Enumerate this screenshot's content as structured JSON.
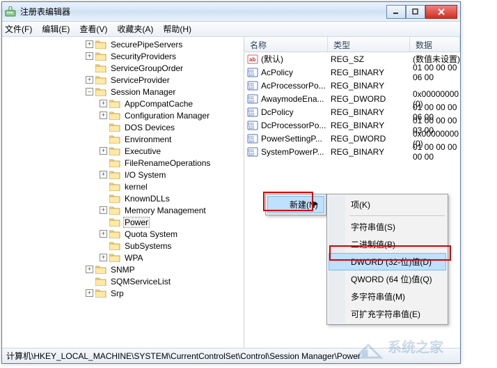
{
  "window": {
    "title": "注册表编辑器"
  },
  "menubar": {
    "file": "文件(F)",
    "edit": "编辑(E)",
    "view": "查看(V)",
    "favorites": "收藏夹(A)",
    "help": "帮助(H)"
  },
  "tree": {
    "items": [
      {
        "depth": 4,
        "exp": "+",
        "label": "SecurePipeServers"
      },
      {
        "depth": 4,
        "exp": "+",
        "label": "SecurityProviders"
      },
      {
        "depth": 4,
        "exp": " ",
        "label": "ServiceGroupOrder"
      },
      {
        "depth": 4,
        "exp": "+",
        "label": "ServiceProvider"
      },
      {
        "depth": 4,
        "exp": "–",
        "label": "Session Manager",
        "open": true
      },
      {
        "depth": 5,
        "exp": "+",
        "label": "AppCompatCache"
      },
      {
        "depth": 5,
        "exp": "+",
        "label": "Configuration Manager"
      },
      {
        "depth": 5,
        "exp": " ",
        "label": "DOS Devices"
      },
      {
        "depth": 5,
        "exp": " ",
        "label": "Environment"
      },
      {
        "depth": 5,
        "exp": "+",
        "label": "Executive"
      },
      {
        "depth": 5,
        "exp": " ",
        "label": "FileRenameOperations"
      },
      {
        "depth": 5,
        "exp": "+",
        "label": "I/O System"
      },
      {
        "depth": 5,
        "exp": " ",
        "label": "kernel"
      },
      {
        "depth": 5,
        "exp": " ",
        "label": "KnownDLLs"
      },
      {
        "depth": 5,
        "exp": "+",
        "label": "Memory Management"
      },
      {
        "depth": 5,
        "exp": " ",
        "label": "Power",
        "selected": true
      },
      {
        "depth": 5,
        "exp": "+",
        "label": "Quota System"
      },
      {
        "depth": 5,
        "exp": " ",
        "label": "SubSystems"
      },
      {
        "depth": 5,
        "exp": "+",
        "label": "WPA"
      },
      {
        "depth": 4,
        "exp": "+",
        "label": "SNMP"
      },
      {
        "depth": 4,
        "exp": " ",
        "label": "SQMServiceList"
      },
      {
        "depth": 4,
        "exp": "+",
        "label": "Srp"
      }
    ]
  },
  "list": {
    "columns": {
      "name": "名称",
      "type": "类型",
      "data": "数据"
    },
    "rows": [
      {
        "icon": "str",
        "name": "(默认)",
        "type": "REG_SZ",
        "data": "(数值未设置)"
      },
      {
        "icon": "bin",
        "name": "AcPolicy",
        "type": "REG_BINARY",
        "data": "01 00 00 00 06 00"
      },
      {
        "icon": "bin",
        "name": "AcProcessorPo...",
        "type": "REG_BINARY",
        "data": ""
      },
      {
        "icon": "bin",
        "name": "AwaymodeEna...",
        "type": "REG_DWORD",
        "data": "0x00000000 (0)"
      },
      {
        "icon": "bin",
        "name": "DcPolicy",
        "type": "REG_BINARY",
        "data": "01 00 00 00 06 00"
      },
      {
        "icon": "bin",
        "name": "DcProcessorPo...",
        "type": "REG_BINARY",
        "data": "01 00 00 00 03 00"
      },
      {
        "icon": "bin",
        "name": "PowerSettingP...",
        "type": "REG_DWORD",
        "data": "0x00000000 (0)"
      },
      {
        "icon": "bin",
        "name": "SystemPowerP...",
        "type": "REG_BINARY",
        "data": "01 00 00 00 00 00"
      }
    ]
  },
  "contextmenu": {
    "new_label": "新建(N)",
    "submenu": [
      {
        "label": "项(K)",
        "sep_after": true
      },
      {
        "label": "字符串值(S)"
      },
      {
        "label": "二进制值(B)"
      },
      {
        "label": "DWORD (32-位)值(D)",
        "highlight": true
      },
      {
        "label": "QWORD (64 位)值(Q)"
      },
      {
        "label": "多字符串值(M)"
      },
      {
        "label": "可扩充字符串值(E)"
      }
    ]
  },
  "statusbar": {
    "path": "计算机\\HKEY_LOCAL_MACHINE\\SYSTEM\\CurrentControlSet\\Control\\Session Manager\\Power"
  },
  "watermark": "系统之家"
}
